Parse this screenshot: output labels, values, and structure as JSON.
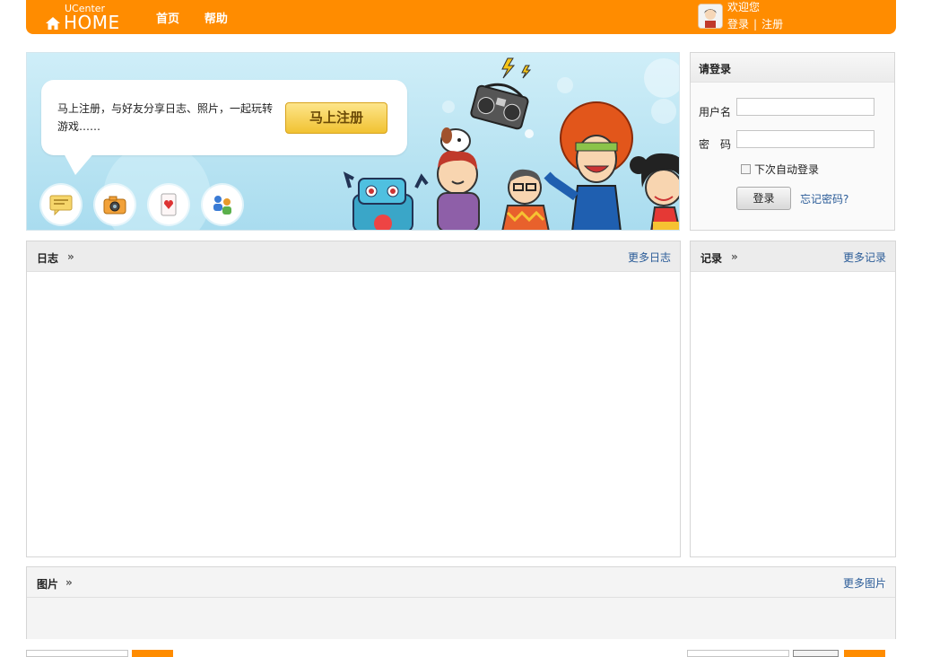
{
  "header": {
    "logo_small": "UCenter",
    "logo_big": "HOME",
    "nav": [
      "首页",
      "帮助"
    ],
    "welcome": "欢迎您",
    "login_link": "登录",
    "separator": "|",
    "register_link": "注册",
    "brand_color": "#ff8c00"
  },
  "banner": {
    "intro_text": "马上注册，与好友分享日志、照片，一起玩转游戏……",
    "register_button": "马上注册",
    "icons": [
      "comment-icon",
      "camera-icon",
      "card-game-icon",
      "friends-icon"
    ]
  },
  "login": {
    "title": "请登录",
    "username_label": "用户名",
    "password_label": "密　码",
    "username_value": "",
    "password_value": "",
    "remember_label": "下次自动登录",
    "remember_checked": false,
    "submit_label": "登录",
    "forgot_label": "忘记密码?"
  },
  "panels": {
    "blog": {
      "title": "日志",
      "arrow": "»",
      "more": "更多日志"
    },
    "record": {
      "title": "记录",
      "arrow": "»",
      "more": "更多记录"
    },
    "photo": {
      "title": "图片",
      "arrow": "»",
      "more": "更多图片"
    }
  }
}
